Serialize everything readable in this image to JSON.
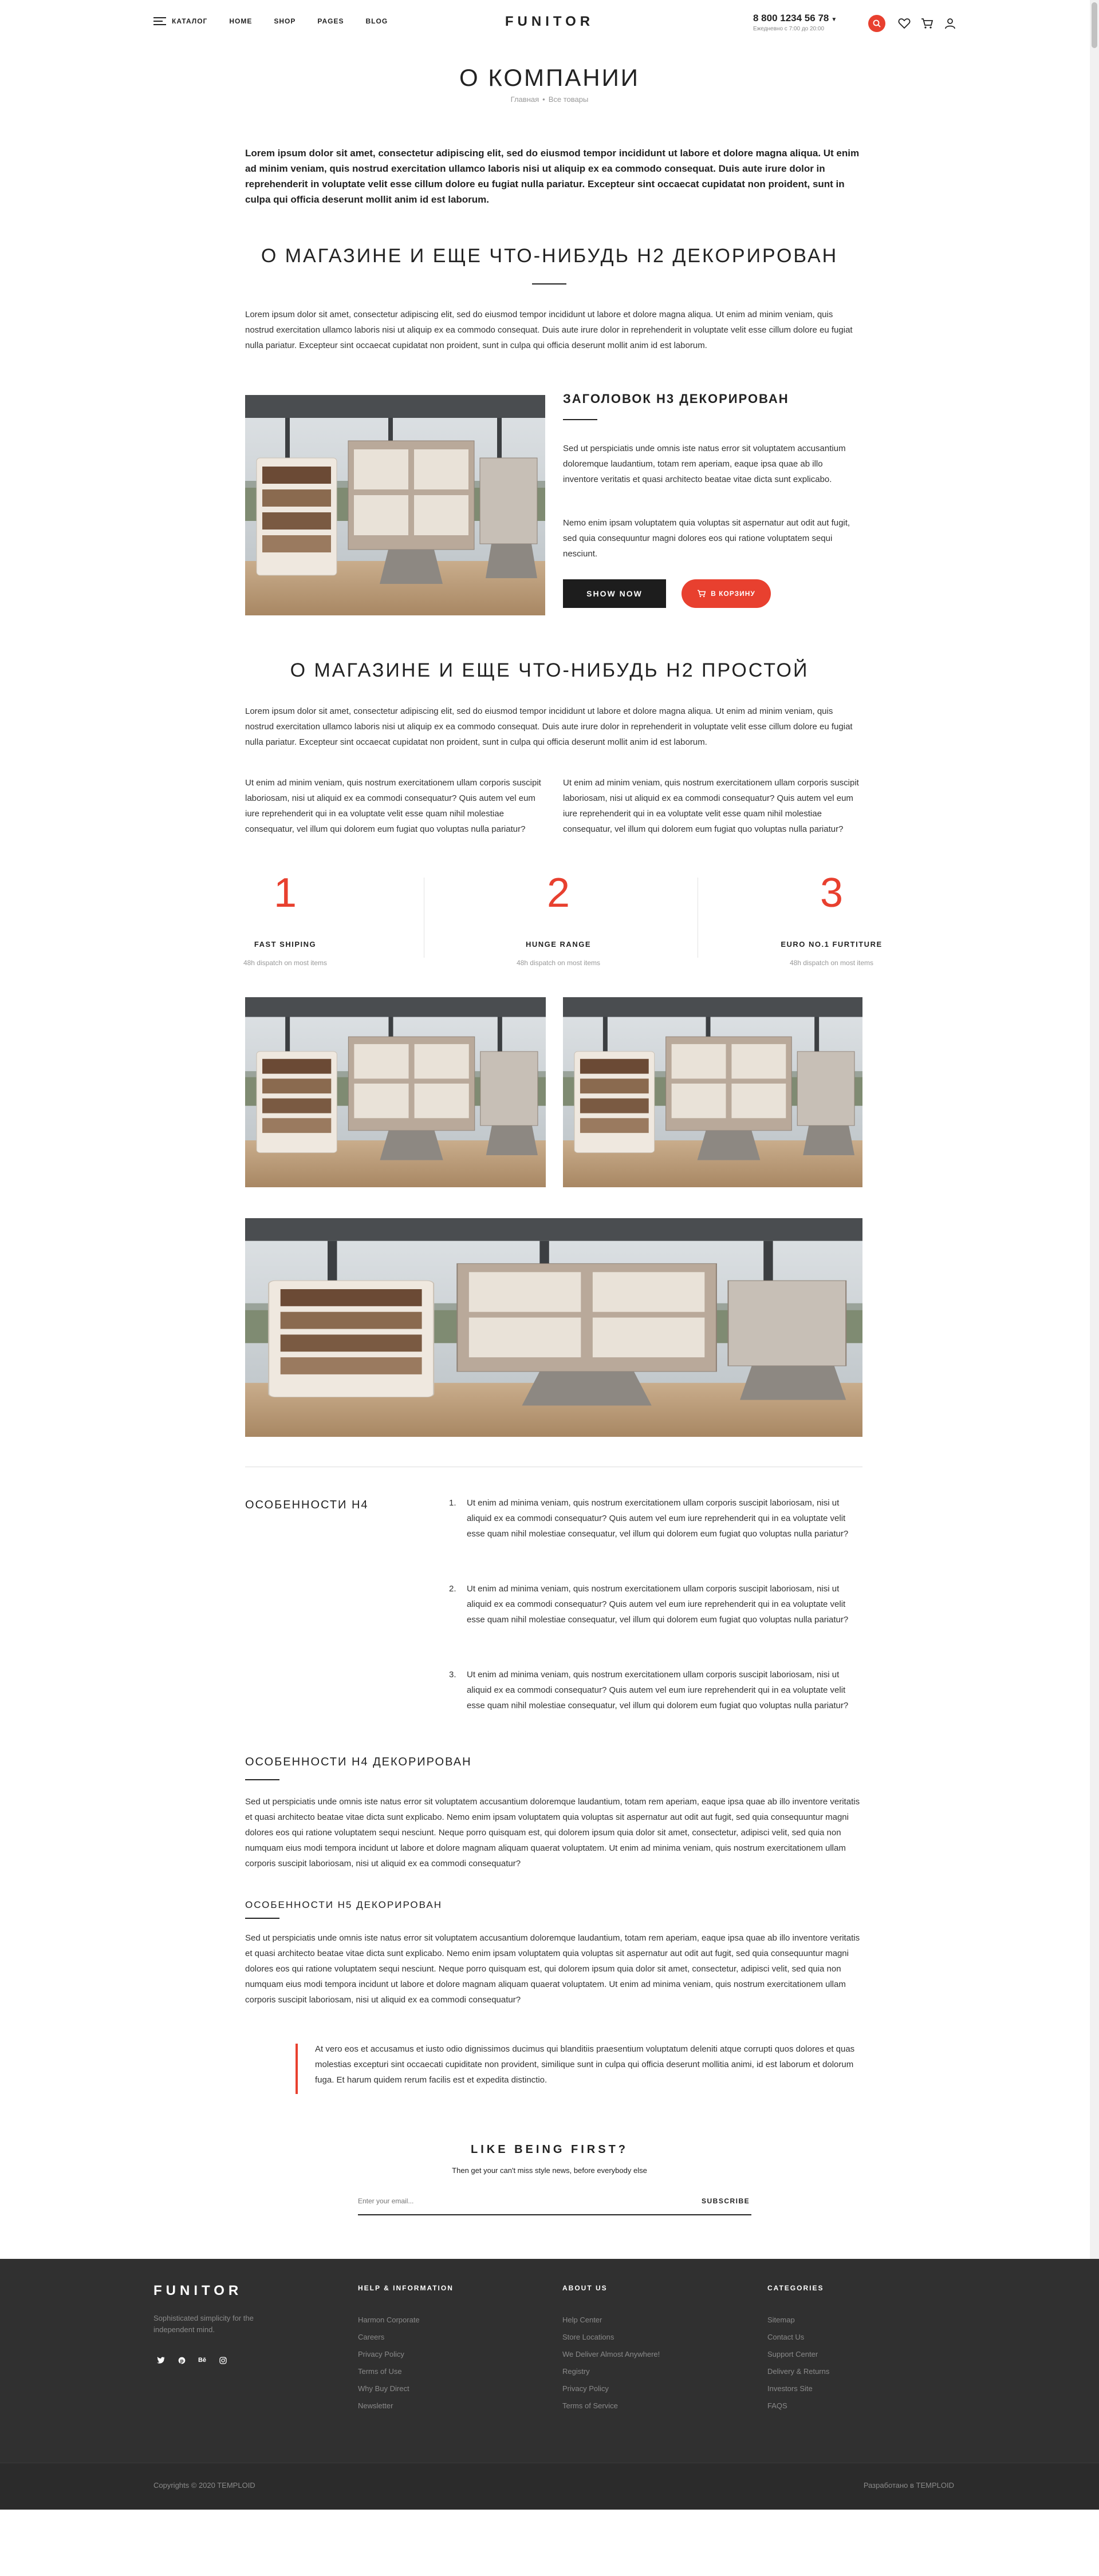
{
  "header": {
    "nav": [
      "Каталог",
      "Home",
      "Shop",
      "Pages",
      "Blog"
    ],
    "logo": "FUNITOR",
    "phone": "8 800 1234 56 78",
    "hours": "Ежедневно с 7:00 до 20:00"
  },
  "hero": {
    "title": "О КОМПАНИИ",
    "breadcrumb_home": "Главная",
    "breadcrumb_sep": "•",
    "breadcrumb_current": "Все товары"
  },
  "lead": "Lorem ipsum dolor sit amet, consectetur adipiscing elit, sed do eiusmod tempor incididunt ut labore et dolore magna aliqua. Ut enim ad minim veniam, quis nostrud exercitation ullamco laboris nisi ut aliquip ex ea commodo consequat. Duis aute irure dolor in reprehenderit in voluptate velit esse cillum dolore eu fugiat nulla pariatur. Excepteur sint occaecat cupidatat non proident, sunt in culpa qui officia deserunt mollit anim id est laborum.",
  "section1": {
    "title": "О МАГАЗИНЕ И ЕЩЕ ЧТО-НИБУДЬ H2 ДЕКОРИРОВАН",
    "text": "Lorem ipsum dolor sit amet, consectetur adipiscing elit, sed do eiusmod tempor incididunt ut labore et dolore magna aliqua. Ut enim ad minim veniam, quis nostrud exercitation ullamco laboris nisi ut aliquip ex ea commodo consequat. Duis aute irure dolor in reprehenderit in voluptate velit esse cillum dolore eu fugiat nulla pariatur. Excepteur sint occaecat cupidatat non proident, sunt in culpa qui officia deserunt mollit anim id est laborum."
  },
  "h3block": {
    "title": "ЗАГОЛОВОК H3 ДЕКОРИРОВАН",
    "para1": "Sed ut perspiciatis unde omnis iste natus error sit voluptatem accusantium doloremque laudantium, totam rem aperiam, eaque ipsa quae ab illo inventore veritatis et quasi architecto beatae vitae dicta sunt explicabo.",
    "para2": "Nemo enim ipsam voluptatem quia voluptas sit aspernatur aut odit aut fugit, sed quia consequuntur magni dolores eos qui ratione voluptatem sequi nesciunt.",
    "btn_show": "SHOW NOW",
    "btn_cart": "В КОРЗИНУ"
  },
  "section2": {
    "title": "О МАГАЗИНЕ И ЕЩЕ ЧТО-НИБУДЬ H2 ПРОСТОЙ",
    "text": "Lorem ipsum dolor sit amet, consectetur adipiscing elit, sed do eiusmod tempor incididunt ut labore et dolore magna aliqua. Ut enim ad minim veniam, quis nostrud exercitation ullamco laboris nisi ut aliquip ex ea commodo consequat. Duis aute irure dolor in reprehenderit in voluptate velit esse cillum dolore eu fugiat nulla pariatur. Excepteur sint occaecat cupidatat non proident, sunt in culpa qui officia deserunt mollit anim id est laborum.",
    "col_left": "Ut enim ad minim veniam, quis nostrum exercitationem ullam corporis suscipit laboriosam, nisi ut aliquid ex ea commodi consequatur? Quis autem vel eum iure reprehenderit qui in ea voluptate velit esse quam nihil molestiae consequatur, vel illum qui dolorem eum fugiat quo voluptas nulla pariatur?",
    "col_right": "Ut enim ad minim veniam, quis nostrum exercitationem ullam corporis suscipit laboriosam, nisi ut aliquid ex ea commodi consequatur? Quis autem vel eum iure reprehenderit qui in ea voluptate velit esse quam nihil molestiae consequatur, vel illum qui dolorem eum fugiat quo voluptas nulla pariatur?"
  },
  "features": [
    {
      "num": "1",
      "title": "FAST SHIPING",
      "sub": "48h dispatch on most items"
    },
    {
      "num": "2",
      "title": "HUNGE RANGE",
      "sub": "48h dispatch on most items"
    },
    {
      "num": "3",
      "title": "EURO NO.1 FURTITURE",
      "sub": "48h dispatch on most items"
    }
  ],
  "h4block": {
    "title": "ОСОБЕННОСТИ H4",
    "items": [
      "Ut enim ad minima veniam, quis nostrum exercitationem ullam corporis suscipit laboriosam, nisi ut aliquid ex ea commodi consequatur? Quis autem vel eum iure reprehenderit qui in ea voluptate velit esse quam nihil molestiae consequatur, vel illum qui dolorem eum fugiat quo voluptas nulla pariatur?",
      "Ut enim ad minima veniam, quis nostrum exercitationem ullam corporis suscipit laboriosam, nisi ut aliquid ex ea commodi consequatur? Quis autem vel eum iure reprehenderit qui in ea voluptate velit esse quam nihil molestiae consequatur, vel illum qui dolorem eum fugiat quo voluptas nulla pariatur?",
      "Ut enim ad minima veniam, quis nostrum exercitationem ullam corporis suscipit laboriosam, nisi ut aliquid ex ea commodi consequatur? Quis autem vel eum iure reprehenderit qui in ea voluptate velit esse quam nihil molestiae consequatur, vel illum qui dolorem eum fugiat quo voluptas nulla pariatur?"
    ]
  },
  "h4deco": {
    "title": "ОСОБЕННОСТИ H4 ДЕКОРИРОВАН",
    "text": "Sed ut perspiciatis unde omnis iste natus error sit voluptatem accusantium doloremque laudantium, totam rem aperiam, eaque ipsa quae ab illo inventore veritatis et quasi architecto beatae vitae dicta sunt explicabo. Nemo enim ipsam voluptatem quia voluptas sit aspernatur aut odit aut fugit, sed quia consequuntur magni dolores eos qui ratione voluptatem sequi nesciunt. Neque porro quisquam est, qui dolorem ipsum quia dolor sit amet, consectetur, adipisci velit, sed quia non numquam eius modi tempora incidunt ut labore et dolore magnam aliquam quaerat voluptatem. Ut enim ad minima veniam, quis nostrum exercitationem ullam corporis suscipit laboriosam, nisi ut aliquid ex ea commodi consequatur?"
  },
  "h5deco": {
    "title": "ОСОБЕННОСТИ H5 ДЕКОРИРОВАН",
    "text": "Sed ut perspiciatis unde omnis iste natus error sit voluptatem accusantium doloremque laudantium, totam rem aperiam, eaque ipsa quae ab illo inventore veritatis et quasi architecto beatae vitae dicta sunt explicabo. Nemo enim ipsam voluptatem quia voluptas sit aspernatur aut odit aut fugit, sed quia consequuntur magni dolores eos qui ratione voluptatem sequi nesciunt. Neque porro quisquam est, qui dolorem ipsum quia dolor sit amet, consectetur, adipisci velit, sed quia non numquam eius modi tempora incidunt ut labore et dolore magnam aliquam quaerat voluptatem. Ut enim ad minima veniam, quis nostrum exercitationem ullam corporis suscipit laboriosam, nisi ut aliquid ex ea commodi consequatur?"
  },
  "quote": "At vero eos et accusamus et iusto odio dignissimos ducimus qui blanditiis praesentium voluptatum deleniti atque corrupti quos dolores et quas molestias excepturi sint occaecati cupiditate non provident, similique sunt in culpa qui officia deserunt mollitia animi, id est laborum et dolorum fuga. Et harum quidem rerum facilis est et expedita distinctio.",
  "subscribe": {
    "title": "LIKE BEING FIRST?",
    "desc": "Then get your can't miss style news, before everybody else",
    "placeholder": "Enter your email...",
    "button": "SUBSCRIBE"
  },
  "footer": {
    "logo": "FUNITOR",
    "tagline": "Sophisticated simplicity for the independent mind.",
    "social": [
      "twitter-icon",
      "pinterest-icon",
      "behance-icon",
      "instagram-icon"
    ],
    "social_behance_label": "Bē",
    "col1": {
      "title": "HELP & INFORMATION",
      "links": [
        "Harmon Corporate",
        "Careers",
        "Privacy Policy",
        "Terms of Use",
        "Why Buy Direct",
        "Newsletter"
      ]
    },
    "col2": {
      "title": "ABOUT US",
      "links": [
        "Help Center",
        "Store Locations",
        "We Deliver Almost Anywhere!",
        "Registry",
        "Privacy Policy",
        "Terms of Service"
      ]
    },
    "col3": {
      "title": "CATEGORIES",
      "links": [
        "Sitemap",
        "Contact Us",
        "Support Center",
        "Delivery & Returns",
        "Investors Site",
        "FAQS"
      ]
    },
    "copyright": "Copyrights © 2020 TEMPLOID",
    "developed": "Разработано в TEMPLOID"
  },
  "colors": {
    "accent": "#e8402f",
    "dark": "#1d1d1d",
    "footer": "#303030"
  }
}
